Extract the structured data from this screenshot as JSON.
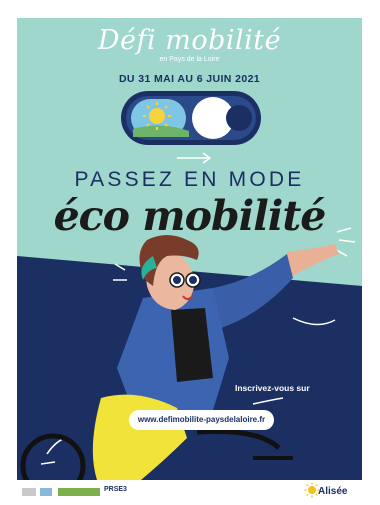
{
  "brand": {
    "title": "Défi mobilité",
    "subtitle": "en Pays de la Loire"
  },
  "dates": "DU 31 MAI AU 6 JUIN 2021",
  "headline": "PASSEZ EN MODE",
  "headline2": "éco mobilité",
  "cta": "Inscrivez-vous sur",
  "url": "www.defimobilite-paysdelaloire.fr",
  "footer": {
    "prse": "PRSE3",
    "alisee": "Alisée"
  },
  "icons": [
    "sun-icon",
    "moon-toggle-icon",
    "arrow-right-icon",
    "cyclist-illustration"
  ],
  "colors": {
    "mint": "#9fd7cc",
    "navy": "#1b2f63",
    "yellow": "#f2e33a",
    "white": "#ffffff"
  }
}
